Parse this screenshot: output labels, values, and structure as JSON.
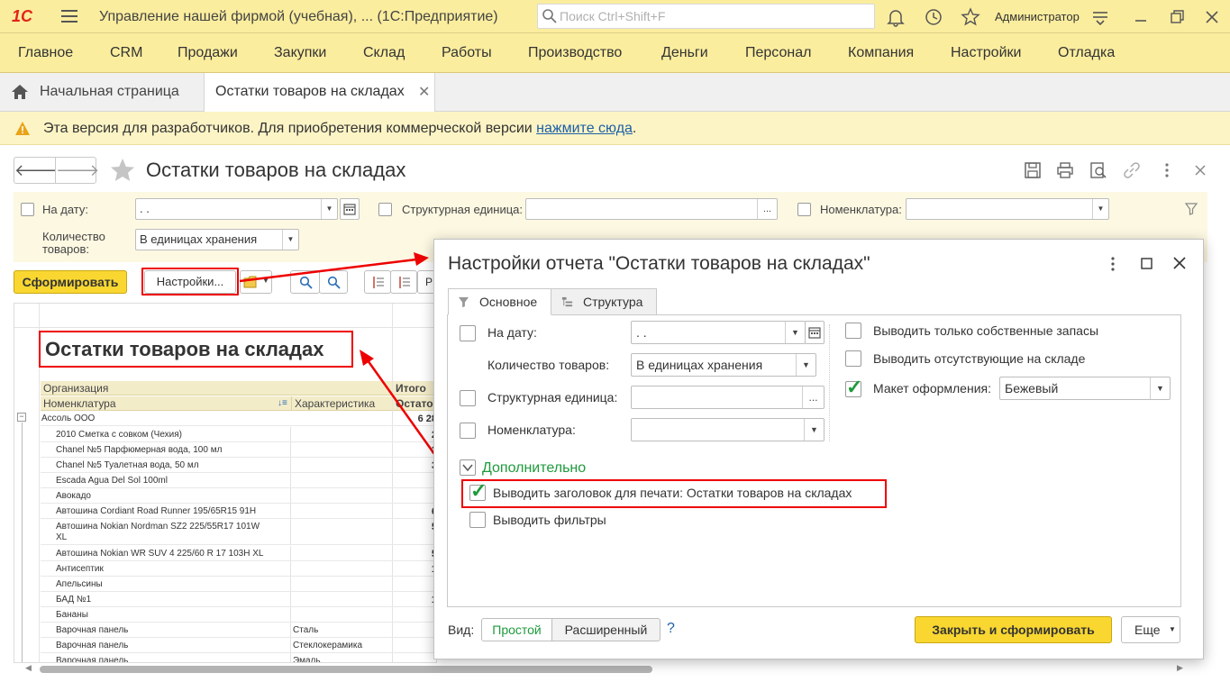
{
  "app": {
    "logo_text": "1С",
    "title": "Управление нашей фирмой (учебная), ... (1С:Предприятие)",
    "search_placeholder": "Поиск Ctrl+Shift+F",
    "user": "Администратор",
    "accent_color": "#fbed9e"
  },
  "menu": [
    "Главное",
    "CRM",
    "Продажи",
    "Закупки",
    "Склад",
    "Работы",
    "Производство",
    "Деньги",
    "Персонал",
    "Компания",
    "Настройки",
    "Отладка"
  ],
  "tabs": {
    "home": "Начальная страница",
    "active": "Остатки товаров на складах",
    "close": "✕"
  },
  "banner": {
    "text": "Эта версия для разработчиков. Для приобретения коммерческой версии ",
    "link": "нажмите сюда",
    "tail": "."
  },
  "form": {
    "title": "Остатки товаров на складах",
    "filters": {
      "date_label": "На дату:",
      "date_value": ". .",
      "qty_label": "Количество товаров:",
      "qty_value": "В единицах хранения",
      "unit_label": "Структурная единица:",
      "unit_more": "...",
      "nom_label": "Номенклатура:"
    },
    "buttons": {
      "generate": "Сформировать",
      "settings": "Настройки...",
      "partial": "Р"
    }
  },
  "report": {
    "title": "Остатки товаров на складах",
    "col_org": "Организация",
    "col_nom": "Номенклатура",
    "col_char": "Характеристика",
    "col_total": "Итого",
    "col_total2": "Остато",
    "group": {
      "name": "Ассоль ООО",
      "value": "6 28"
    },
    "rows": [
      {
        "name": "2010 Сметка с совком (Чехия)",
        "char": "",
        "value": "2"
      },
      {
        "name": "Chanel №5 Парфюмерная вода, 100 мл",
        "char": "",
        "value": "2"
      },
      {
        "name": "Chanel №5 Туалетная вода, 50 мл",
        "char": "",
        "value": "3"
      },
      {
        "name": "Escada Agua Del Sol 100ml",
        "char": "",
        "value": ""
      },
      {
        "name": "Авокадо",
        "char": "",
        "value": ""
      },
      {
        "name": "Автошина Cordiant Road Runner 195/65R15 91H",
        "char": "",
        "value": "6"
      },
      {
        "name": "Автошина Nokian Nordman SZ2 225/55R17 101W",
        "name2": "XL",
        "char": "",
        "value": "5"
      },
      {
        "name": "Автошина Nokian WR SUV 4 225/60 R 17 103H XL",
        "char": "",
        "value": "5"
      },
      {
        "name": "Антисептик",
        "char": "",
        "value": "1"
      },
      {
        "name": "Апельсины",
        "char": "",
        "value": ""
      },
      {
        "name": "БАД №1",
        "char": "",
        "value": "1"
      },
      {
        "name": "Бананы",
        "char": "",
        "value": ""
      },
      {
        "name": "Варочная панель",
        "char": "Сталь",
        "value": ""
      },
      {
        "name": "Варочная панель",
        "char": "Стеклокерамика",
        "value": ""
      },
      {
        "name": "Варочная панель",
        "char": "Эмаль",
        "value": ""
      }
    ]
  },
  "dialog": {
    "title": "Настройки отчета \"Остатки товаров на складах\"",
    "tab_main": "Основное",
    "tab_structure": "Структура",
    "date_label": "На дату:",
    "date_value": ". .",
    "qty_label": "Количество товаров:",
    "qty_value": "В единицах хранения",
    "unit_label": "Структурная единица:",
    "unit_more": "...",
    "nom_label": "Номенклатура:",
    "own_stock": "Выводить только собственные запасы",
    "missing": "Выводить отсутствующие на складе",
    "layout_label": "Макет оформления:",
    "layout_value": "Бежевый",
    "extra_label": "Дополнительно",
    "print_header": "Выводить заголовок для печати: Остатки товаров на складах",
    "show_filters": "Выводить фильтры",
    "view_label": "Вид:",
    "view_simple": "Простой",
    "view_extended": "Расширенный",
    "help": "?",
    "btn_close_generate": "Закрыть и сформировать",
    "btn_more": "Еще"
  }
}
